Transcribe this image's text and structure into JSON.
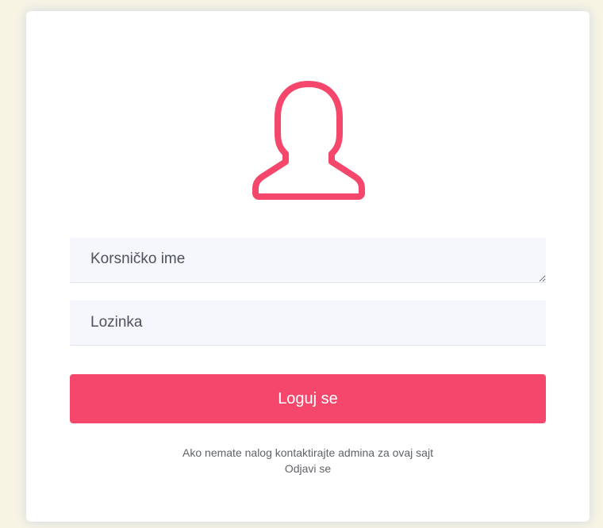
{
  "colors": {
    "accent": "#f4476b",
    "field_background": "#f6f7fc",
    "page_background": "#f7f4e4"
  },
  "avatar": {
    "icon": "user-outline-icon"
  },
  "form": {
    "username_placeholder": "Korsničko ime",
    "password_placeholder": "Lozinka",
    "submit_label": "Loguj se"
  },
  "footer": {
    "message": "Ako nemate nalog kontaktirajte admina za ovaj sajt",
    "logout_link": "Odjavi se"
  }
}
